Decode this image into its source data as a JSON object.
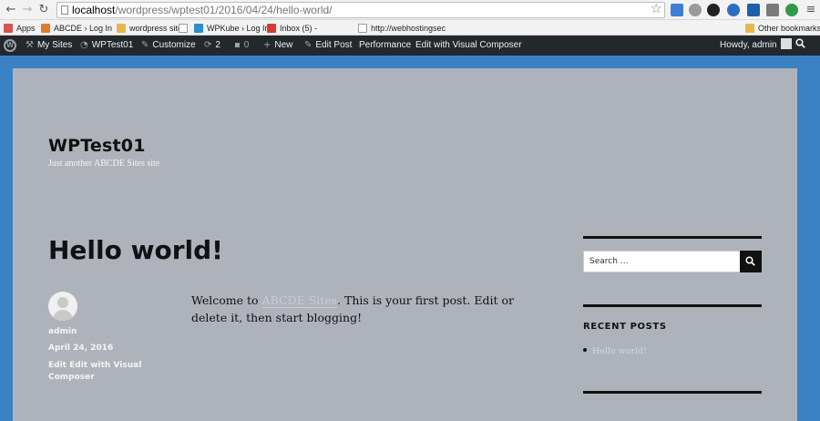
{
  "browser": {
    "url_host": "localhost",
    "url_path": "/wordpress/wptest01/2016/04/24/hello-world/",
    "bookmarks": [
      "Apps",
      "ABCDE › Log In",
      "wordpress sites",
      "WPKube › Log In",
      "Inbox (5) -",
      "http://webhostingsec"
    ],
    "other_bookmarks": "Other bookmarks"
  },
  "adminbar": {
    "my_sites": "My Sites",
    "site_name": "WPTest01",
    "customize": "Customize",
    "updates_count": "2",
    "comments_count": "0",
    "new": "New",
    "edit_post": "Edit Post",
    "performance": "Performance",
    "visual_composer": "Edit with Visual Composer",
    "howdy": "Howdy, admin"
  },
  "site": {
    "title": "WPTest01",
    "description": "Just another ABCDE Sites site"
  },
  "post": {
    "title": "Hello world!",
    "author": "admin",
    "date": "April 24, 2016",
    "edit_line1": "Edit Edit with Visual",
    "edit_line2": "Composer",
    "content_before": "Welcome to ",
    "content_link": "ABCDE Sites",
    "content_after": ". This is your first post. Edit or delete it, then start blogging!"
  },
  "sidebar": {
    "search_placeholder": "Search …",
    "recent_posts_title": "RECENT POSTS",
    "recent_posts": [
      "Hello world!"
    ]
  },
  "colors": {
    "admin_bar": "#23282d",
    "page_background": "#aeb3bb",
    "outer_background": "#3b82c4"
  }
}
